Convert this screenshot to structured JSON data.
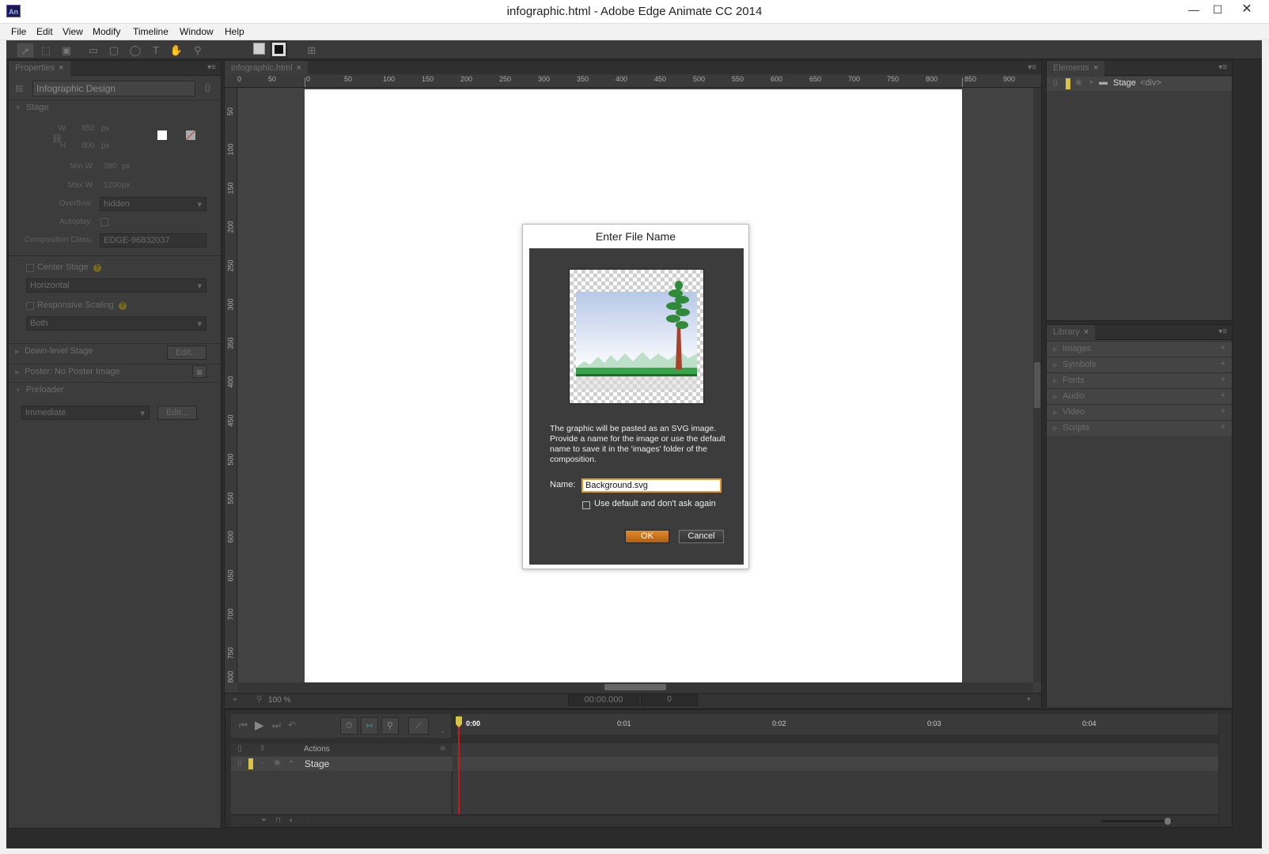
{
  "window": {
    "app_icon_label": "An",
    "title": "infographic.html - Adobe Edge Animate CC 2014",
    "controls": {
      "minimize": "—",
      "maximize": "☐",
      "close": "✕"
    }
  },
  "menu": [
    "File",
    "Edit",
    "View",
    "Modify",
    "Timeline",
    "Window",
    "Help"
  ],
  "properties": {
    "tab": "Properties",
    "object_name": "Infographic Design",
    "section_stage": "Stage",
    "w_label": "W",
    "w_value": "850",
    "w_unit": "px",
    "h_label": "H",
    "h_value": "800",
    "h_unit": "px",
    "min_w_label": "Min W",
    "min_w_value": "380",
    "min_w_unit": "px",
    "max_w_label": "Max W",
    "max_w_value": "1200",
    "max_w_unit": "px",
    "overflow_label": "Overflow:",
    "overflow_value": "hidden",
    "autoplay_label": "Autoplay:",
    "comp_class_label": "Composition Class:",
    "comp_class_value": "EDGE-96832037",
    "center_stage_label": "Center Stage",
    "center_stage_option": "Horizontal",
    "responsive_label": "Responsive Scaling",
    "responsive_option": "Both",
    "downlevel_label": "Down-level Stage",
    "downlevel_button": "Edit...",
    "poster_label": "Poster: No Poster Image",
    "preloader_label": "Preloader",
    "preloader_option": "Immediate",
    "preloader_button": "Edit..."
  },
  "document": {
    "tab": "infographic.html",
    "ruler_h": [
      "0",
      "50",
      "0",
      "50",
      "100",
      "150",
      "200",
      "250",
      "300",
      "350",
      "400",
      "450",
      "500",
      "550",
      "600",
      "650",
      "700",
      "750",
      "800",
      "850",
      "900"
    ],
    "ruler_v": [
      "50",
      "100",
      "150",
      "200",
      "250",
      "300",
      "350",
      "400",
      "450",
      "500",
      "550",
      "600",
      "650",
      "700",
      "750",
      "800"
    ],
    "zoom": "100 %",
    "time": "00:00.000",
    "frame": "0"
  },
  "elements": {
    "tab": "Elements",
    "stage_label": "Stage",
    "stage_tag": "<div>"
  },
  "library": {
    "tab": "Library",
    "sections": [
      "Images",
      "Symbols",
      "Fonts",
      "Audio",
      "Video",
      "Scripts"
    ]
  },
  "dialog": {
    "title": "Enter File Name",
    "message": "The graphic will be pasted as an SVG image. Provide a name for the image or use the default name to save it in the 'images' folder of the composition.",
    "name_label": "Name:",
    "name_value": "Background.svg",
    "checkbox_label": "Use default and don't ask again",
    "ok": "OK",
    "cancel": "Cancel"
  },
  "timeline": {
    "times": [
      "0:00",
      "0:01",
      "0:02",
      "0:03",
      "0:04"
    ],
    "actions_label": "Actions",
    "stage_row_label": "Stage"
  }
}
